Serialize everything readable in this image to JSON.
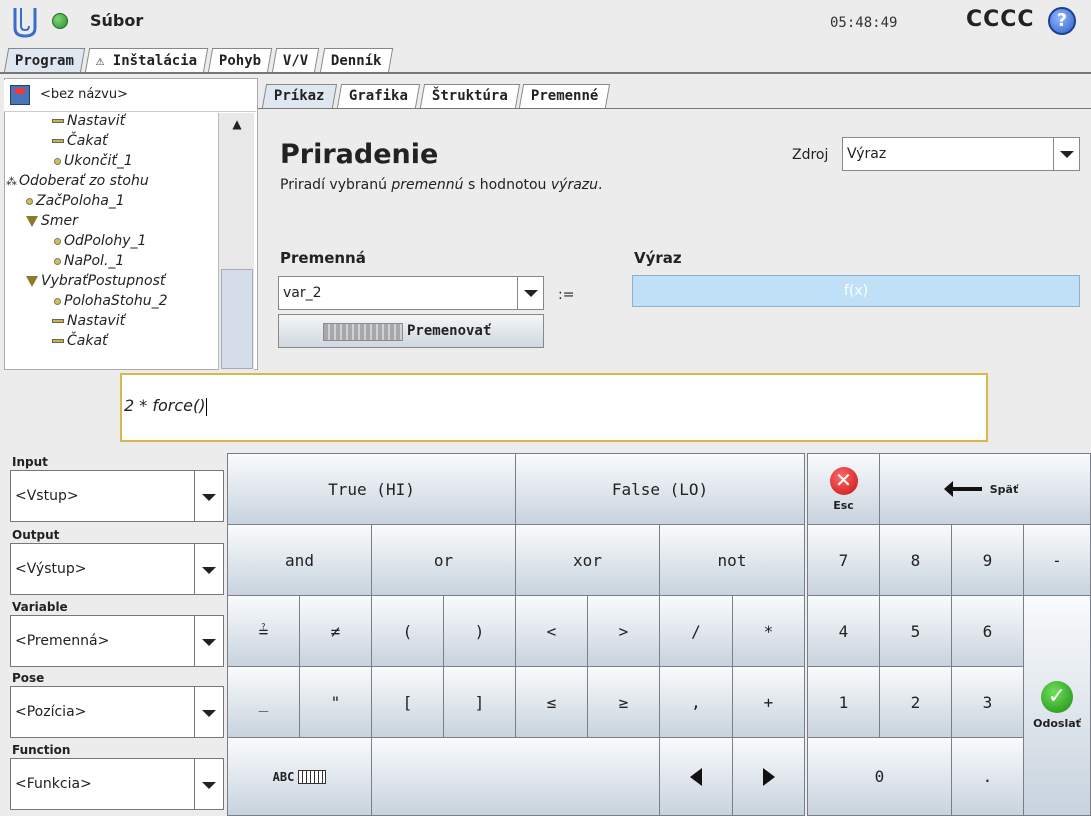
{
  "header": {
    "menu_label": "Súbor",
    "clock": "05:48:49",
    "robot_name": "CCCC",
    "help_symbol": "?"
  },
  "main_tabs": [
    {
      "label": "Program",
      "active": true
    },
    {
      "label": "⚠ Inštalácia",
      "active": false
    },
    {
      "label": "Pohyb",
      "active": false
    },
    {
      "label": "V/V",
      "active": false
    },
    {
      "label": "Denník",
      "active": false
    }
  ],
  "program": {
    "name": "<bez názvu>",
    "tree": [
      {
        "label": "Nastaviť",
        "icon": "yellow-bar"
      },
      {
        "label": "Čakať",
        "icon": "yellow-bar"
      },
      {
        "label": "Ukončiť_1",
        "icon": "yellow-dot"
      },
      {
        "label": "Odoberať zo stohu",
        "icon": "stack-dots"
      },
      {
        "label": "ZačPoloha_1",
        "icon": "yellow-dot"
      },
      {
        "label": "Smer",
        "icon": "triangle"
      },
      {
        "label": "OdPolohy_1",
        "icon": "yellow-dot"
      },
      {
        "label": "NaPol._1",
        "icon": "yellow-dot"
      },
      {
        "label": "VybraťPostupnosť",
        "icon": "triangle"
      },
      {
        "label": "PolohaStohu_2",
        "icon": "yellow-dot"
      },
      {
        "label": "Nastaviť",
        "icon": "yellow-bar"
      },
      {
        "label": "Čakať",
        "icon": "yellow-bar"
      }
    ]
  },
  "sub_tabs": [
    {
      "label": "Príkaz",
      "active": true
    },
    {
      "label": "Grafika",
      "active": false
    },
    {
      "label": "Štruktúra",
      "active": false
    },
    {
      "label": "Premenné",
      "active": false
    }
  ],
  "command": {
    "title": "Priradenie",
    "desc_prefix": "Priradí vybranú ",
    "desc_var": "premennú",
    "desc_mid": " s hodnotou ",
    "desc_expr": "výrazu",
    "desc_suffix": ".",
    "source_label": "Zdroj",
    "source_value": "Výraz",
    "variable_label": "Premenná",
    "variable_value": "var_2",
    "assign_symbol": ":=",
    "expression_label": "Výraz",
    "expression_placeholder": "f(x)",
    "rename_label": "Premenovať"
  },
  "expression": {
    "text": "2 * force()"
  },
  "selectors": [
    {
      "label": "Input",
      "value": "<Vstup>"
    },
    {
      "label": "Output",
      "value": "<Výstup>"
    },
    {
      "label": "Variable",
      "value": "<Premenná>"
    },
    {
      "label": "Pose",
      "value": "<Pozícia>"
    },
    {
      "label": "Function",
      "value": "<Funkcia>"
    }
  ],
  "keys": {
    "true": "True (HI)",
    "false": "False (LO)",
    "esc": "Esc",
    "back": "Späť",
    "and": "and",
    "or": "or",
    "xor": "xor",
    "not": "not",
    "eq": "≟",
    "neq": "≠",
    "lparen": "(",
    "rparen": ")",
    "lt": "<",
    "gt": ">",
    "div": "/",
    "mul": "*",
    "underscore": "_",
    "quote": "\"",
    "lbracket": "[",
    "rbracket": "]",
    "le": "≤",
    "ge": "≥",
    "comma": ",",
    "plus": "+",
    "abc": "ABC",
    "n7": "7",
    "n8": "8",
    "n9": "9",
    "minus": "-",
    "n4": "4",
    "n5": "5",
    "n6": "6",
    "n1": "1",
    "n2": "2",
    "n3": "3",
    "n0": "0",
    "dot": ".",
    "submit": "Odoslať"
  }
}
